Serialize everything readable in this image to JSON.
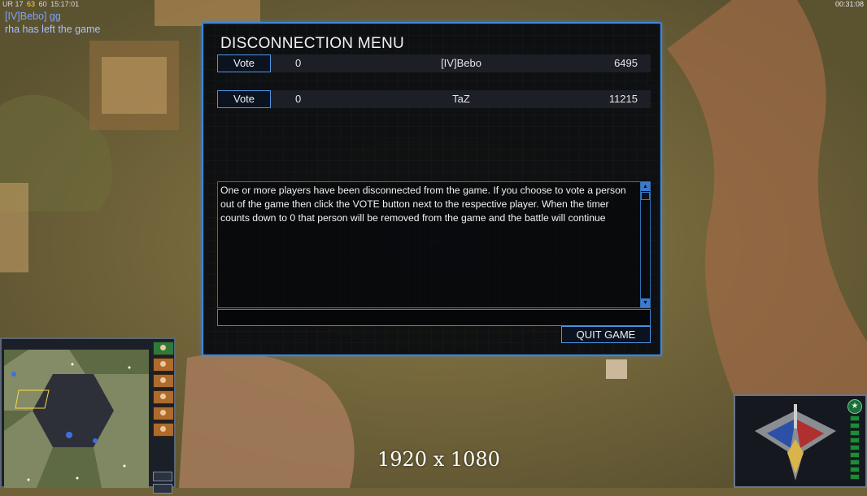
{
  "hud": {
    "stats": [
      "UR 17",
      "63",
      "60",
      "15:17:01"
    ],
    "clock": "00:31:08"
  },
  "chat": [
    "[IV]Bebo] gg",
    "rha has left the game"
  ],
  "dialog": {
    "title": "DISCONNECTION MENU",
    "players": [
      {
        "vote_label": "Vote",
        "votes": "0",
        "name": "[IV]Bebo",
        "score": "6495"
      },
      {
        "vote_label": "Vote",
        "votes": "0",
        "name": "TaZ",
        "score": "11215"
      }
    ],
    "message": "One or more players have been disconnected from the game. If you choose to vote a person out of the game then click the VOTE button next to the respective player. When the timer counts down to 0 that person will be removed from the game and the battle will continue",
    "chat_input_value": "",
    "quit_label": "QUIT GAME",
    "accent_color": "#3f86d8"
  },
  "overlay": {
    "resolution_text": "1920 x 1080"
  },
  "icons": {
    "scroll_up": "scroll-up-icon",
    "scroll_down": "scroll-down-icon",
    "faction": "faction-emblem-icon",
    "power": "power-star-icon"
  }
}
